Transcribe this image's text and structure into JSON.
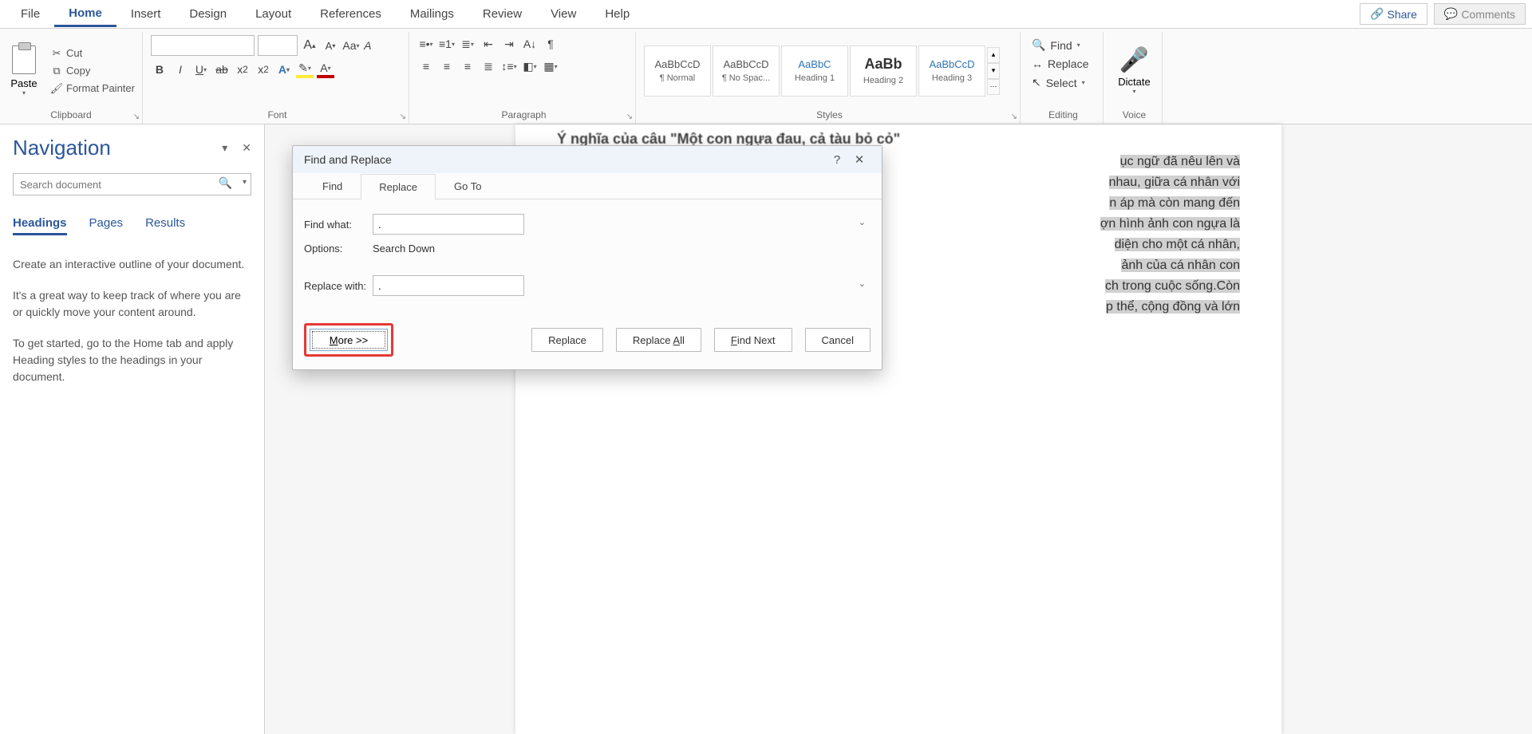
{
  "ribbon_tabs": {
    "file": "File",
    "home": "Home",
    "insert": "Insert",
    "design": "Design",
    "layout": "Layout",
    "references": "References",
    "mailings": "Mailings",
    "review": "Review",
    "view": "View",
    "help": "Help"
  },
  "top_buttons": {
    "share": "Share",
    "comments": "Comments"
  },
  "groups": {
    "clipboard": {
      "label": "Clipboard",
      "paste": "Paste",
      "cut": "Cut",
      "copy": "Copy",
      "format_painter": "Format Painter"
    },
    "font": {
      "label": "Font"
    },
    "paragraph": {
      "label": "Paragraph"
    },
    "styles": {
      "label": "Styles",
      "items": [
        {
          "preview": "AaBbCcD",
          "name": "¶ Normal"
        },
        {
          "preview": "AaBbCcD",
          "name": "¶ No Spac..."
        },
        {
          "preview": "AaBbC",
          "name": "Heading 1"
        },
        {
          "preview": "AaBb",
          "name": "Heading 2"
        },
        {
          "preview": "AaBbCcD",
          "name": "Heading 3"
        }
      ]
    },
    "editing": {
      "label": "Editing",
      "find": "Find",
      "replace": "Replace",
      "select": "Select"
    },
    "voice": {
      "label": "Voice",
      "dictate": "Dictate"
    }
  },
  "nav": {
    "title": "Navigation",
    "search_placeholder": "Search document",
    "tabs": {
      "headings": "Headings",
      "pages": "Pages",
      "results": "Results"
    },
    "body": {
      "p1": "Create an interactive outline of your document.",
      "p2": "It's a great way to keep track of where you are or quickly move your content around.",
      "p3": "To get started, go to the Home tab and apply Heading styles to the headings in your document."
    }
  },
  "doc": {
    "heading_fragment": "Ý nghĩa của câu \"Một con ngựa đau, cả tàu bỏ cỏ\"",
    "lines": [
      "ục ngữ đã nêu lên và",
      "nhau, giữa cá nhân với",
      "n áp mà còn mang đến",
      "ợn hình ảnh con ngựa là",
      "diện cho một cá nhân,",
      "ảnh của cá nhân con",
      "ch trong cuộc sống.Còn",
      "p thể, cộng đồng và lớn"
    ]
  },
  "dialog": {
    "title": "Find and Replace",
    "tabs": {
      "find": "Find",
      "replace": "Replace",
      "goto": "Go To"
    },
    "find_label": "Find what:",
    "find_value": ".",
    "options_label": "Options:",
    "options_value": "Search Down",
    "replace_label": "Replace with:",
    "replace_value": ".",
    "buttons": {
      "more": "More >>",
      "replace": "Replace",
      "replace_all_pre": "Replace ",
      "replace_all_u": "A",
      "replace_all_post": "ll",
      "find_next_u": "F",
      "find_next_post": "ind Next",
      "cancel": "Cancel"
    }
  }
}
